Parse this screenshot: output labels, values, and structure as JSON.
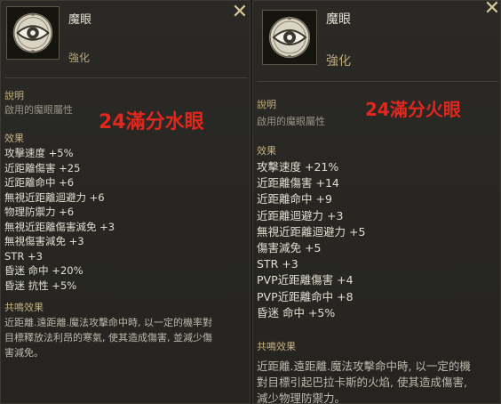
{
  "left": {
    "name": "魔眼",
    "type": "強化",
    "desc_label": "說明",
    "desc_text": "啟用的魔眼屬性",
    "annotation": "24滿分水眼",
    "effect_label": "效果",
    "stats": [
      "攻擊速度 +5%",
      "近距離傷害 +25",
      "近距離命中 +6",
      "無視近距離迴避力 +6",
      "物理防禦力 +6",
      "無視近距離傷害減免 +3",
      "無視傷害減免 +3",
      "STR +3",
      "昏迷 命中 +20%",
      "昏迷 抗性 +5%"
    ],
    "resonance_label": "共鳴效果",
    "resonance_lines": [
      "近距離.遠距離.魔法攻擊命中時, 以一定的機率對",
      "目標釋放法利昂的寒氣, 使其造成傷害, 並減少傷",
      "害減免。"
    ]
  },
  "right": {
    "name": "魔眼",
    "type": "強化",
    "desc_label": "說明",
    "desc_text": "啟用的魔眼屬性",
    "annotation": "24滿分火眼",
    "effect_label": "效果",
    "stats": [
      "攻擊速度 +21%",
      "近距離傷害 +14",
      "近距離命中 +9",
      "近距離迴避力 +3",
      "無視近距離迴避力 +5",
      "傷害減免 +5",
      "STR +3",
      "PVP近距離傷害 +4",
      "PVP近距離命中 +8",
      "昏迷 命中 +5%"
    ],
    "resonance_label": "共鳴效果",
    "resonance_lines": [
      "近距離.遠距離.魔法攻擊命中時, 以一定的機",
      "對目標引起巴拉卡斯的火焰, 使其造成傷害,",
      "減少物理防禦力。"
    ]
  },
  "colors": {
    "panel_bg": "#272622",
    "section_gold": "#c7b27f",
    "annotation_red": "#e0261d",
    "stat_text": "#e2ddd0"
  },
  "icons": [
    "eye-emblem-icon",
    "close-x-icon"
  ]
}
